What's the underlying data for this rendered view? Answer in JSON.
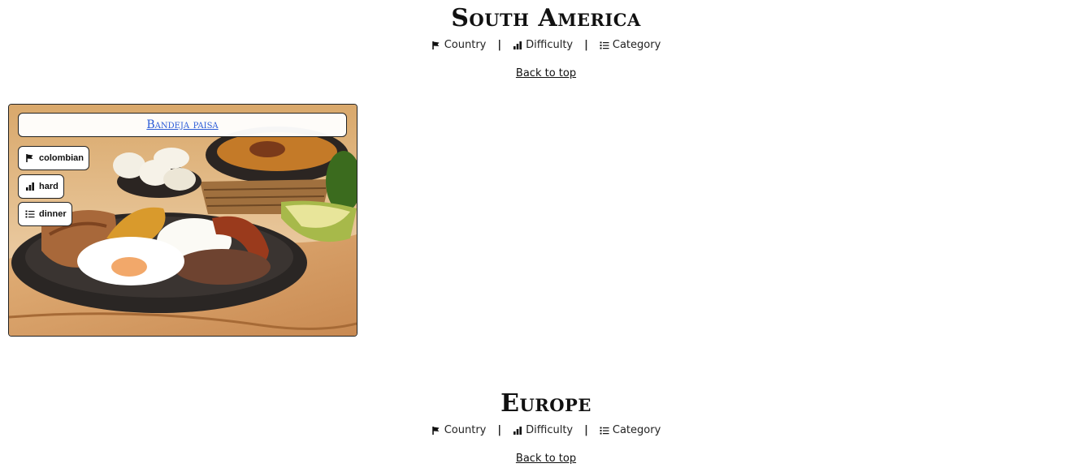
{
  "sections": [
    {
      "title": "South America",
      "legend": {
        "country_label": "Country",
        "difficulty_label": "Difficulty",
        "category_label": "Category",
        "separator": "|"
      },
      "back_to_top": "Back to top",
      "recipes": [
        {
          "name": "Bandeja paisa",
          "country": "colombian",
          "difficulty": "hard",
          "category": "dinner"
        }
      ]
    },
    {
      "title": "Europe",
      "legend": {
        "country_label": "Country",
        "difficulty_label": "Difficulty",
        "category_label": "Category",
        "separator": "|"
      },
      "back_to_top": "Back to top"
    }
  ],
  "icons": {
    "country": "flag-icon",
    "difficulty": "signal-bars-icon",
    "category": "list-icon"
  },
  "colors": {
    "link": "#2a5bd7",
    "text": "#111111",
    "background": "#ffffff"
  }
}
